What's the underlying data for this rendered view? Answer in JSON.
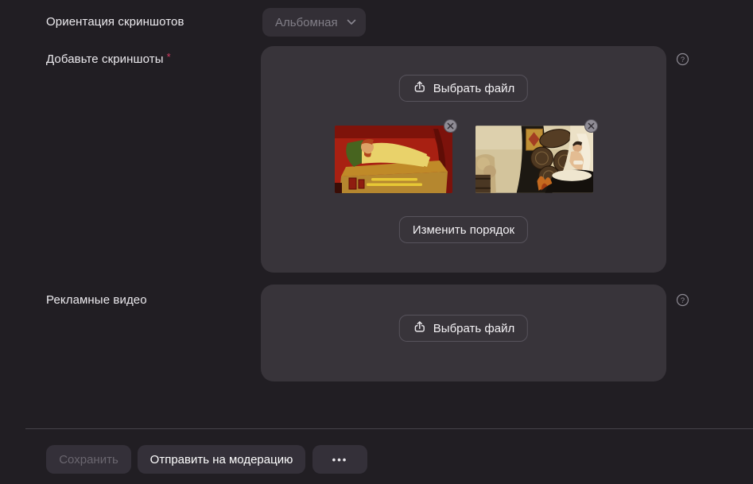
{
  "colors": {
    "page_background": "#211e23",
    "panel_background": "#38343a",
    "button_fill": "#343039",
    "outline_button_border": "#57535c",
    "required_mark": "#d23b61",
    "disabled_text": "#6a666f",
    "muted_text": "#817e87",
    "label_text": "#edebef"
  },
  "orientation_row": {
    "label": "Ориентация скриншотов",
    "select_value": "Альбомная"
  },
  "screenshots_section": {
    "label": "Добавьте скриншоты",
    "required_mark": "*",
    "choose_file_label": "Выбрать файл",
    "reorder_label": "Изменить порядок",
    "help_glyph": "?",
    "thumbnails": [
      {
        "name": "screenshot-thumbnail-1"
      },
      {
        "name": "screenshot-thumbnail-2"
      }
    ]
  },
  "videos_section": {
    "label": "Рекламные видео",
    "choose_file_label": "Выбрать файл",
    "help_glyph": "?"
  },
  "footer": {
    "save_label": "Сохранить",
    "submit_label": "Отправить на модерацию",
    "more_glyph": "•••"
  }
}
